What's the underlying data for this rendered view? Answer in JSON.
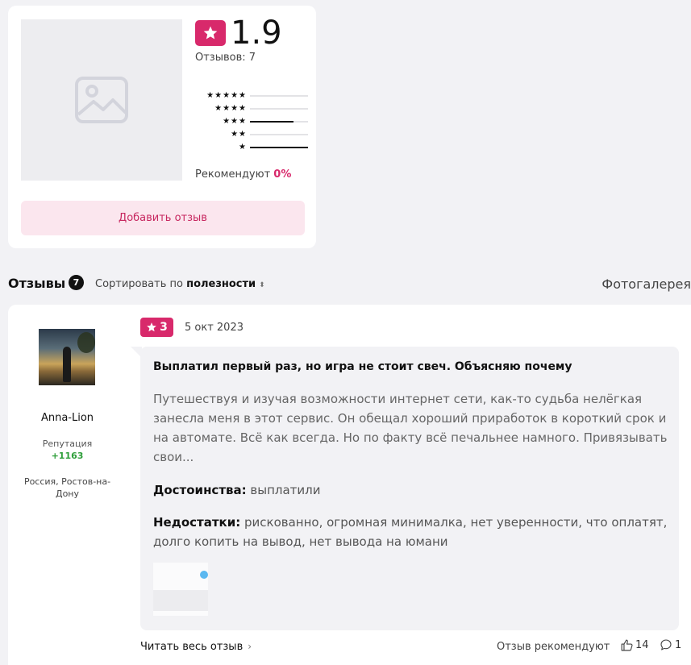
{
  "summary": {
    "rating": "1.9",
    "reviews_count_label": "Отзывов: 7",
    "distribution": [
      {
        "stars": "★★★★★",
        "fraction": 0
      },
      {
        "stars": "★★★★",
        "fraction": 0
      },
      {
        "stars": "★★★",
        "fraction": 0.75
      },
      {
        "stars": "★★",
        "fraction": 0
      },
      {
        "stars": "★",
        "fraction": 1.0
      }
    ],
    "recommend_label": "Рекомендуют ",
    "recommend_value": "0%",
    "add_review_label": "Добавить отзыв"
  },
  "reviews_header": {
    "title": "Отзывы",
    "count": "7",
    "sort_prefix": "Сортировать по ",
    "sort_value": "полезности",
    "gallery_label": "Фотогалерея"
  },
  "review": {
    "user": {
      "name": "Anna-Lion",
      "reputation_label": "Репутация",
      "reputation_value": "+1163",
      "location": "Россия, Ростов-на-Дону"
    },
    "rating": "3",
    "date": "5 окт 2023",
    "title": "Выплатил первый раз, но игра не стоит свеч. Объясняю почему",
    "text": "Путешествуя и изучая возможности интернет сети, как-то судьба нелёгкая занесла меня в этот сервис. Он обещал хороший приработок в короткий срок и на автомате. Всё как всегда. Но по факту всё печальнее намного. Привязывать свои...",
    "pros_label": "Достоинства:",
    "pros_text": " выплатили",
    "cons_label": "Недостатки:",
    "cons_text": " рискованно, огромная минималка, нет уверенности, что оплатят, долго копить на вывод, нет вывода на юмани",
    "read_full_label": "Читать весь отзыв",
    "recommend_label": "Отзыв рекомендуют",
    "likes": "14",
    "comments": "1"
  },
  "colors": {
    "accent": "#d8296b",
    "accent_light": "#fbe6ee",
    "reputation": "#2e9e3a",
    "background": "#f2f2f5"
  },
  "icons": [
    "image-placeholder-icon",
    "star-icon",
    "sort-arrows-icon",
    "chevron-right-icon",
    "thumbs-up-icon",
    "comment-icon"
  ]
}
